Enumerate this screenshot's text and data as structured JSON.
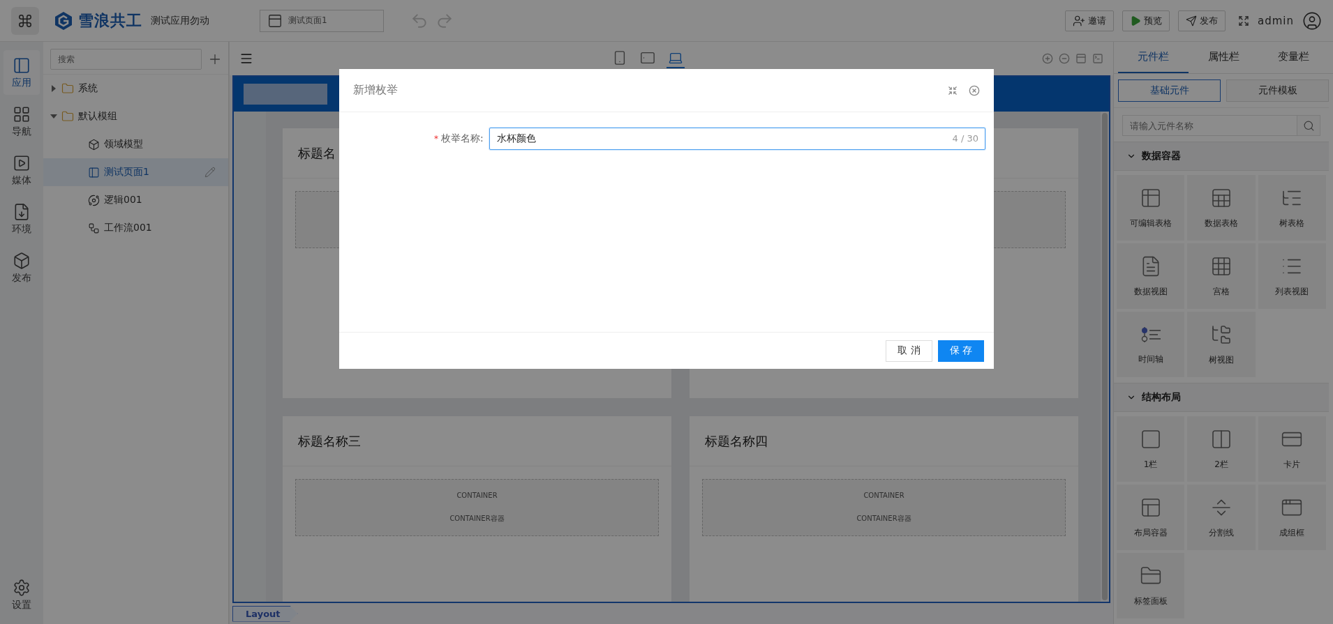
{
  "app_bar": {
    "logo": "雪浪共工",
    "app_name": "测试应用勿动",
    "page_selector": "测试页面1",
    "actions": [
      {
        "kind": "invite",
        "label": "邀请"
      },
      {
        "kind": "preview",
        "label": "预览"
      },
      {
        "kind": "publish",
        "label": "发布"
      }
    ],
    "user": "admin"
  },
  "rail": [
    {
      "kind": "app",
      "label": "应用",
      "selected": true
    },
    {
      "kind": "nav",
      "label": "导航",
      "selected": false
    },
    {
      "kind": "media",
      "label": "媒体",
      "selected": false
    },
    {
      "kind": "env",
      "label": "环境",
      "selected": false
    },
    {
      "kind": "publish",
      "label": "发布",
      "selected": false
    }
  ],
  "rail_bottom": {
    "kind": "settings",
    "label": "设置"
  },
  "tree": {
    "search_placeholder": "搜索",
    "items": [
      {
        "kind": "folder",
        "label": "系统",
        "expanded": false,
        "selected": false
      },
      {
        "kind": "folder",
        "label": "默认模组",
        "expanded": true,
        "selected": false,
        "children": [
          {
            "kind": "model",
            "label": "领域模型",
            "selected": false
          },
          {
            "kind": "page",
            "label": "测试页面1",
            "selected": true
          },
          {
            "kind": "logic",
            "label": "逻辑001",
            "selected": false
          },
          {
            "kind": "workflow",
            "label": "工作流001",
            "selected": false
          }
        ]
      }
    ]
  },
  "canvas": {
    "devices": [
      {
        "kind": "phone",
        "selected": false
      },
      {
        "kind": "tablet",
        "selected": false
      },
      {
        "kind": "desktop",
        "selected": true
      }
    ],
    "cards": [
      {
        "kind": "card",
        "title": "标题名"
      },
      {
        "kind": "card"
      },
      {
        "kind": "card",
        "title": "标题名称三",
        "container_lines": [
          "CONTAINER",
          "CONTAINER容器"
        ]
      },
      {
        "kind": "card",
        "title": "标题名称四",
        "container_lines": [
          "CONTAINER",
          "CONTAINER容器"
        ]
      }
    ],
    "breadcrumb": "Layout"
  },
  "panel": {
    "tabs": [
      {
        "label": "元件栏",
        "selected": true
      },
      {
        "label": "属性栏",
        "selected": false
      },
      {
        "label": "变量栏",
        "selected": false
      }
    ],
    "subtabs": [
      {
        "label": "基础元件",
        "selected": true
      },
      {
        "label": "元件模板",
        "selected": false
      }
    ],
    "search_placeholder": "请输入元件名称",
    "groups": [
      {
        "title": "数据容器",
        "expanded": true,
        "items": [
          {
            "kind": "editable-table",
            "label": "可编辑表格"
          },
          {
            "kind": "data-table",
            "label": "数据表格"
          },
          {
            "kind": "tree-table",
            "label": "树表格"
          },
          {
            "kind": "data-view",
            "label": "数据视图"
          },
          {
            "kind": "grid",
            "label": "宫格"
          },
          {
            "kind": "list-view",
            "label": "列表视图"
          },
          {
            "kind": "timeline",
            "label": "时间轴"
          },
          {
            "kind": "tree-view",
            "label": "树视图"
          }
        ]
      },
      {
        "title": "结构布局",
        "expanded": true,
        "items": [
          {
            "kind": "one-column",
            "label": "1栏"
          },
          {
            "kind": "two-column",
            "label": "2栏"
          },
          {
            "kind": "card",
            "label": "卡片"
          },
          {
            "kind": "layout",
            "label": "布局容器"
          },
          {
            "kind": "divider",
            "label": "分割线"
          },
          {
            "kind": "group-box",
            "label": "成组框"
          },
          {
            "kind": "tab-panel",
            "label": "标签面板"
          }
        ]
      }
    ]
  },
  "dialog": {
    "title": "新增枚举",
    "field": {
      "label": "枚举名称:",
      "required_mark": "*",
      "value": "水杯颜色",
      "counter": "4 / 30"
    },
    "buttons": [
      {
        "kind": "default",
        "label": "取 消"
      },
      {
        "kind": "primary",
        "label": "保 存"
      }
    ]
  }
}
